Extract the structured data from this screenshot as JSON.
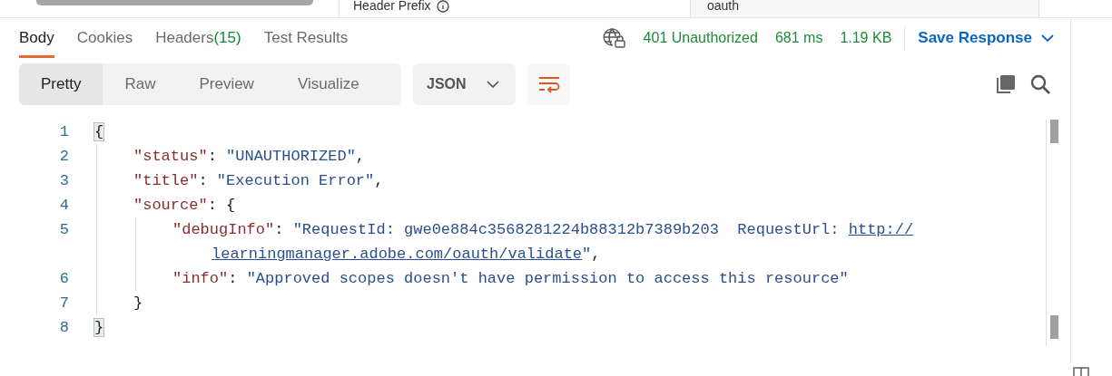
{
  "top_strip": {
    "left_label": "Header Prefix",
    "right_value": "oauth"
  },
  "tabs": [
    {
      "label": "Body",
      "selected": true
    },
    {
      "label": "Cookies",
      "selected": false
    },
    {
      "label": "Headers",
      "count": "(15)",
      "selected": false
    },
    {
      "label": "Test Results",
      "selected": false
    }
  ],
  "response_meta": {
    "status": "401 Unauthorized",
    "time": "681 ms",
    "size": "1.19 KB",
    "save_button": "Save Response"
  },
  "view_modes": [
    {
      "label": "Pretty",
      "selected": true
    },
    {
      "label": "Raw",
      "selected": false
    },
    {
      "label": "Preview",
      "selected": false
    },
    {
      "label": "Visualize",
      "selected": false
    }
  ],
  "format_dropdown": {
    "value": "JSON"
  },
  "code": {
    "lines": [
      {
        "number": "1",
        "parts": [
          {
            "kind": "punct",
            "text": "{",
            "matched": true
          }
        ],
        "children": [
          {
            "number": "2",
            "parts": [
              {
                "kind": "key",
                "text": "\"status\""
              },
              {
                "kind": "punct",
                "text": ": "
              },
              {
                "kind": "string",
                "text": "\"UNAUTHORIZED\""
              },
              {
                "kind": "punct",
                "text": ","
              }
            ]
          },
          {
            "number": "3",
            "parts": [
              {
                "kind": "key",
                "text": "\"title\""
              },
              {
                "kind": "punct",
                "text": ": "
              },
              {
                "kind": "string",
                "text": "\"Execution Error\""
              },
              {
                "kind": "punct",
                "text": ","
              }
            ]
          },
          {
            "number": "4",
            "parts": [
              {
                "kind": "key",
                "text": "\"source\""
              },
              {
                "kind": "punct",
                "text": ": {"
              }
            ],
            "children": [
              {
                "number": "5",
                "parts": [
                  {
                    "kind": "key",
                    "text": "\"debugInfo\""
                  },
                  {
                    "kind": "punct",
                    "text": ": "
                  },
                  {
                    "kind": "string",
                    "text": "\"RequestId: gwe0e884c3568281224b88312b7389b203  RequestUrl: "
                  },
                  {
                    "kind": "link",
                    "text": "http://"
                  },
                  {
                    "kind": "break"
                  },
                  {
                    "kind": "link",
                    "text": "learningmanager.adobe.com/oauth/validate"
                  },
                  {
                    "kind": "string",
                    "text": "\""
                  },
                  {
                    "kind": "punct",
                    "text": ","
                  }
                ]
              },
              {
                "number": "6",
                "parts": [
                  {
                    "kind": "key",
                    "text": "\"info\""
                  },
                  {
                    "kind": "punct",
                    "text": ": "
                  },
                  {
                    "kind": "string",
                    "text": "\"Approved scopes doesn't have permission to access this resource\""
                  }
                ]
              }
            ]
          },
          {
            "number": "7",
            "parts": [
              {
                "kind": "punct",
                "text": "}"
              }
            ]
          }
        ]
      },
      {
        "number": "8",
        "parts": [
          {
            "kind": "punct",
            "text": "}",
            "matched": true
          }
        ]
      }
    ]
  }
}
